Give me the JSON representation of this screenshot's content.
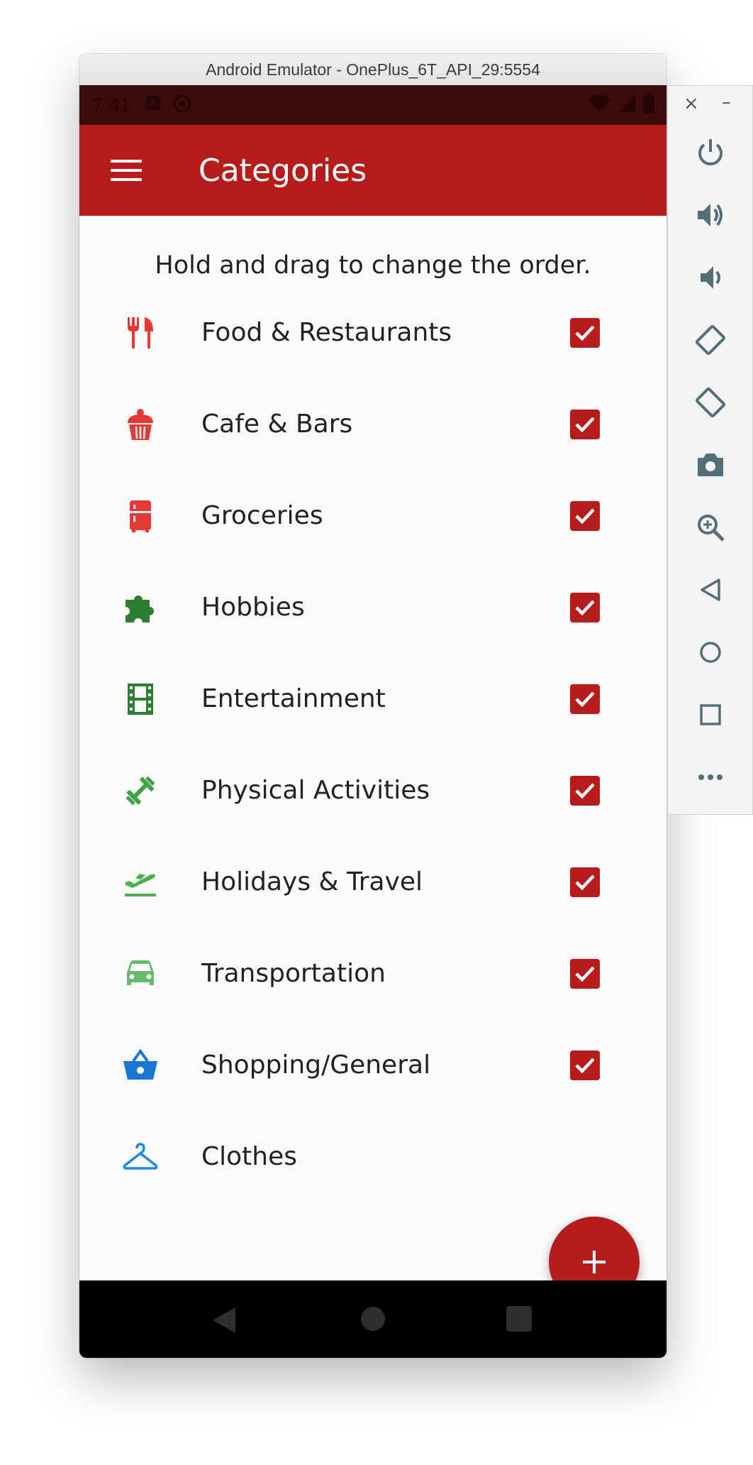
{
  "window": {
    "title": "Android Emulator - OnePlus_6T_API_29:5554"
  },
  "status": {
    "time": "7:41"
  },
  "appbar": {
    "title": "Categories"
  },
  "hint": "Hold and drag to change the order.",
  "categories": [
    {
      "label": "Food & Restaurants",
      "icon": "fork-knife-icon",
      "color": "#e53935",
      "checked": true
    },
    {
      "label": "Cafe & Bars",
      "icon": "cupcake-icon",
      "color": "#e53935",
      "checked": true
    },
    {
      "label": "Groceries",
      "icon": "fridge-icon",
      "color": "#e53935",
      "checked": true
    },
    {
      "label": "Hobbies",
      "icon": "puzzle-icon",
      "color": "#2e7d32",
      "checked": true
    },
    {
      "label": "Entertainment",
      "icon": "film-icon",
      "color": "#2e7d32",
      "checked": true
    },
    {
      "label": "Physical Activities",
      "icon": "dumbbell-icon",
      "color": "#43a047",
      "checked": true
    },
    {
      "label": "Holidays & Travel",
      "icon": "plane-icon",
      "color": "#4caf50",
      "checked": true
    },
    {
      "label": "Transportation",
      "icon": "car-icon",
      "color": "#66bb6a",
      "checked": true
    },
    {
      "label": "Shopping/General",
      "icon": "basket-icon",
      "color": "#1976d2",
      "checked": true
    },
    {
      "label": "Clothes",
      "icon": "hanger-icon",
      "color": "#1e88e5",
      "checked": false
    }
  ],
  "colors": {
    "primary": "#b71c1c",
    "statusbar": "#3e0b0b"
  }
}
